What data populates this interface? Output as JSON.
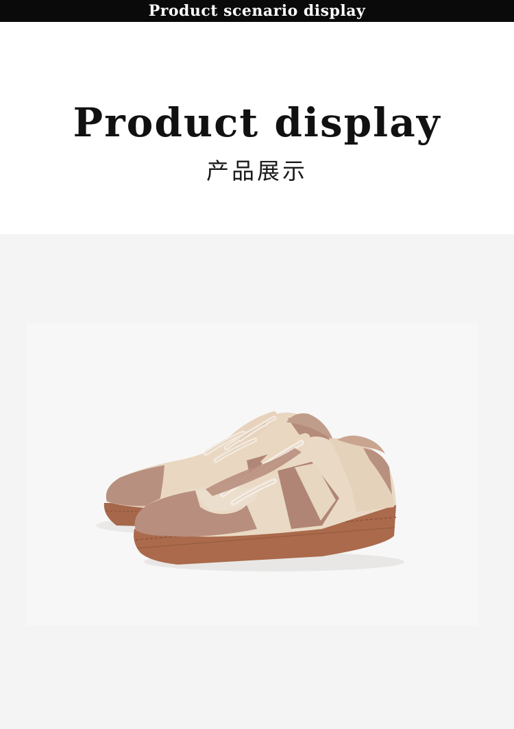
{
  "banner": {
    "text": "Product scenario display"
  },
  "heading": {
    "title_en": "Product display",
    "title_cn": "产品展示"
  },
  "product_image": {
    "icon": "sneakers-pair-image"
  },
  "colors": {
    "banner_bg": "#0a0a0a",
    "scene_bg": "#f4f4f4",
    "sole": "#a9694a",
    "suede": "#b98f7f",
    "leather": "#ead9c4"
  }
}
